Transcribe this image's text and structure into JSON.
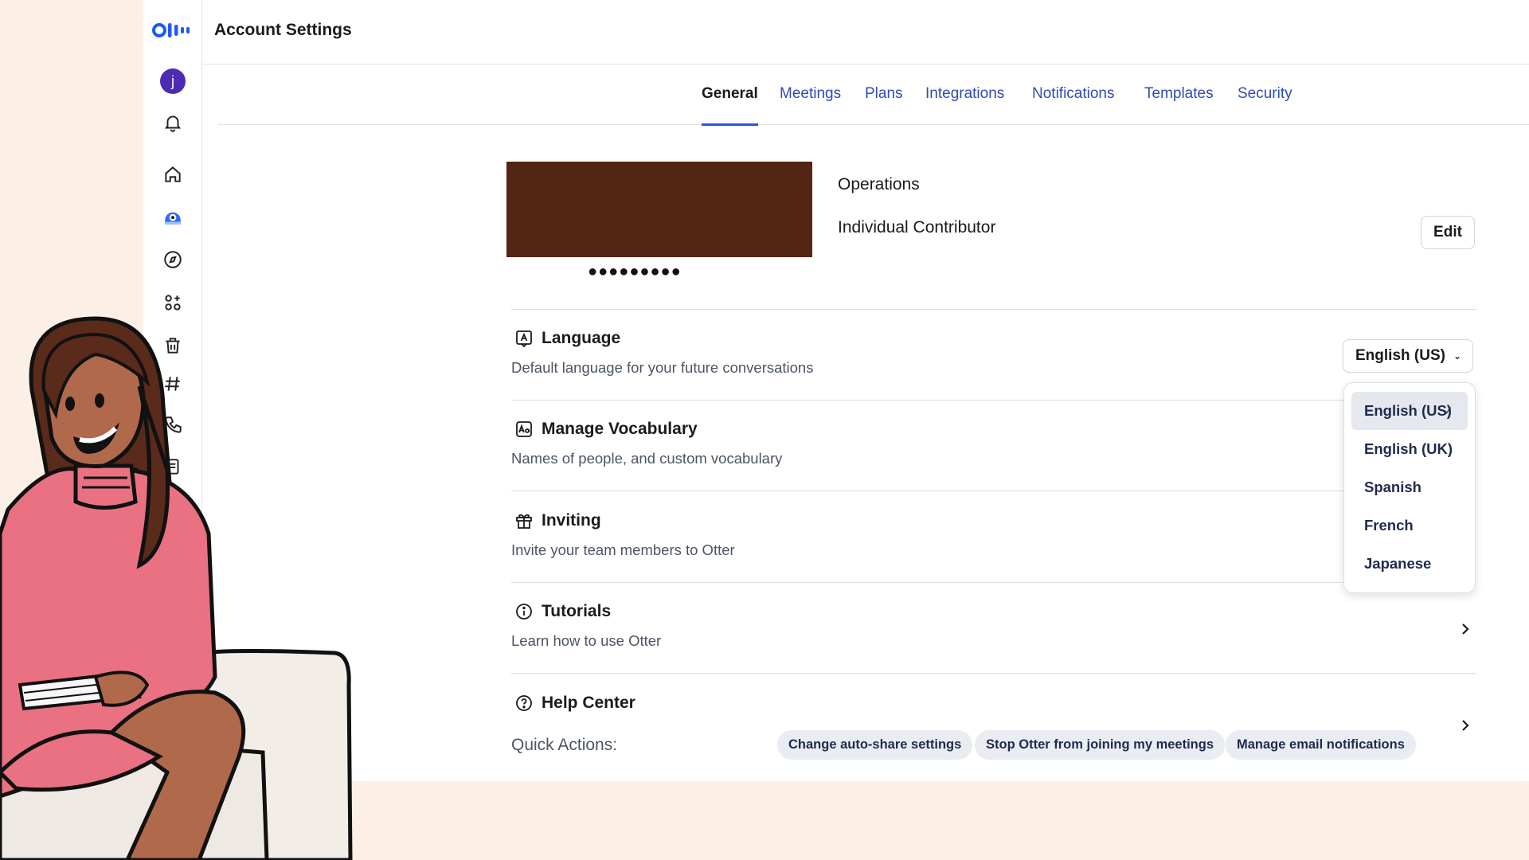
{
  "app": {
    "page_title": "Account Settings",
    "avatar_initial": "j"
  },
  "rail_icons": [
    "notification-bell-icon",
    "home-icon",
    "otter-assistant-icon",
    "compass-icon",
    "apps-icon",
    "trash-icon",
    "channels-hash-icon",
    "phone-icon",
    "doc-icon"
  ],
  "tabs": [
    {
      "label": "General",
      "active": true
    },
    {
      "label": "Meetings"
    },
    {
      "label": "Plans"
    },
    {
      "label": "Integrations"
    },
    {
      "label": "Notifications"
    },
    {
      "label": "Templates"
    },
    {
      "label": "Security"
    }
  ],
  "profile": {
    "name_masked": "●●●●●●●●●",
    "department": "Operations",
    "role": "Individual Contributor",
    "edit_label": "Edit"
  },
  "settings": [
    {
      "title": "Language",
      "desc": "Default language for your future conversations",
      "icon": "language-icon"
    },
    {
      "title": "Manage Vocabulary",
      "desc": "Names of people, and custom vocabulary",
      "icon": "vocabulary-icon"
    },
    {
      "title": "Inviting",
      "desc": "Invite your team members to Otter",
      "icon": "gift-icon"
    },
    {
      "title": "Tutorials",
      "desc": "Learn how to use Otter",
      "icon": "info-icon"
    },
    {
      "title": "Help Center",
      "icon": "help-icon"
    }
  ],
  "language": {
    "selected": "English (US)",
    "options": [
      "English (US)",
      "English (UK)",
      "Spanish",
      "French",
      "Japanese"
    ],
    "check_glyph": "✓"
  },
  "quick_actions": {
    "label": "Quick Actions:",
    "chips": [
      "Change auto-share settings",
      "Stop Otter from joining my meetings",
      "Manage email notifications"
    ]
  },
  "colors": {
    "accent": "#2b55d9",
    "brand_blue": "#1e5af0",
    "avatar": "#4d2bb3",
    "profile_banner": "#532514",
    "backdrop": "#fcf0e6"
  }
}
